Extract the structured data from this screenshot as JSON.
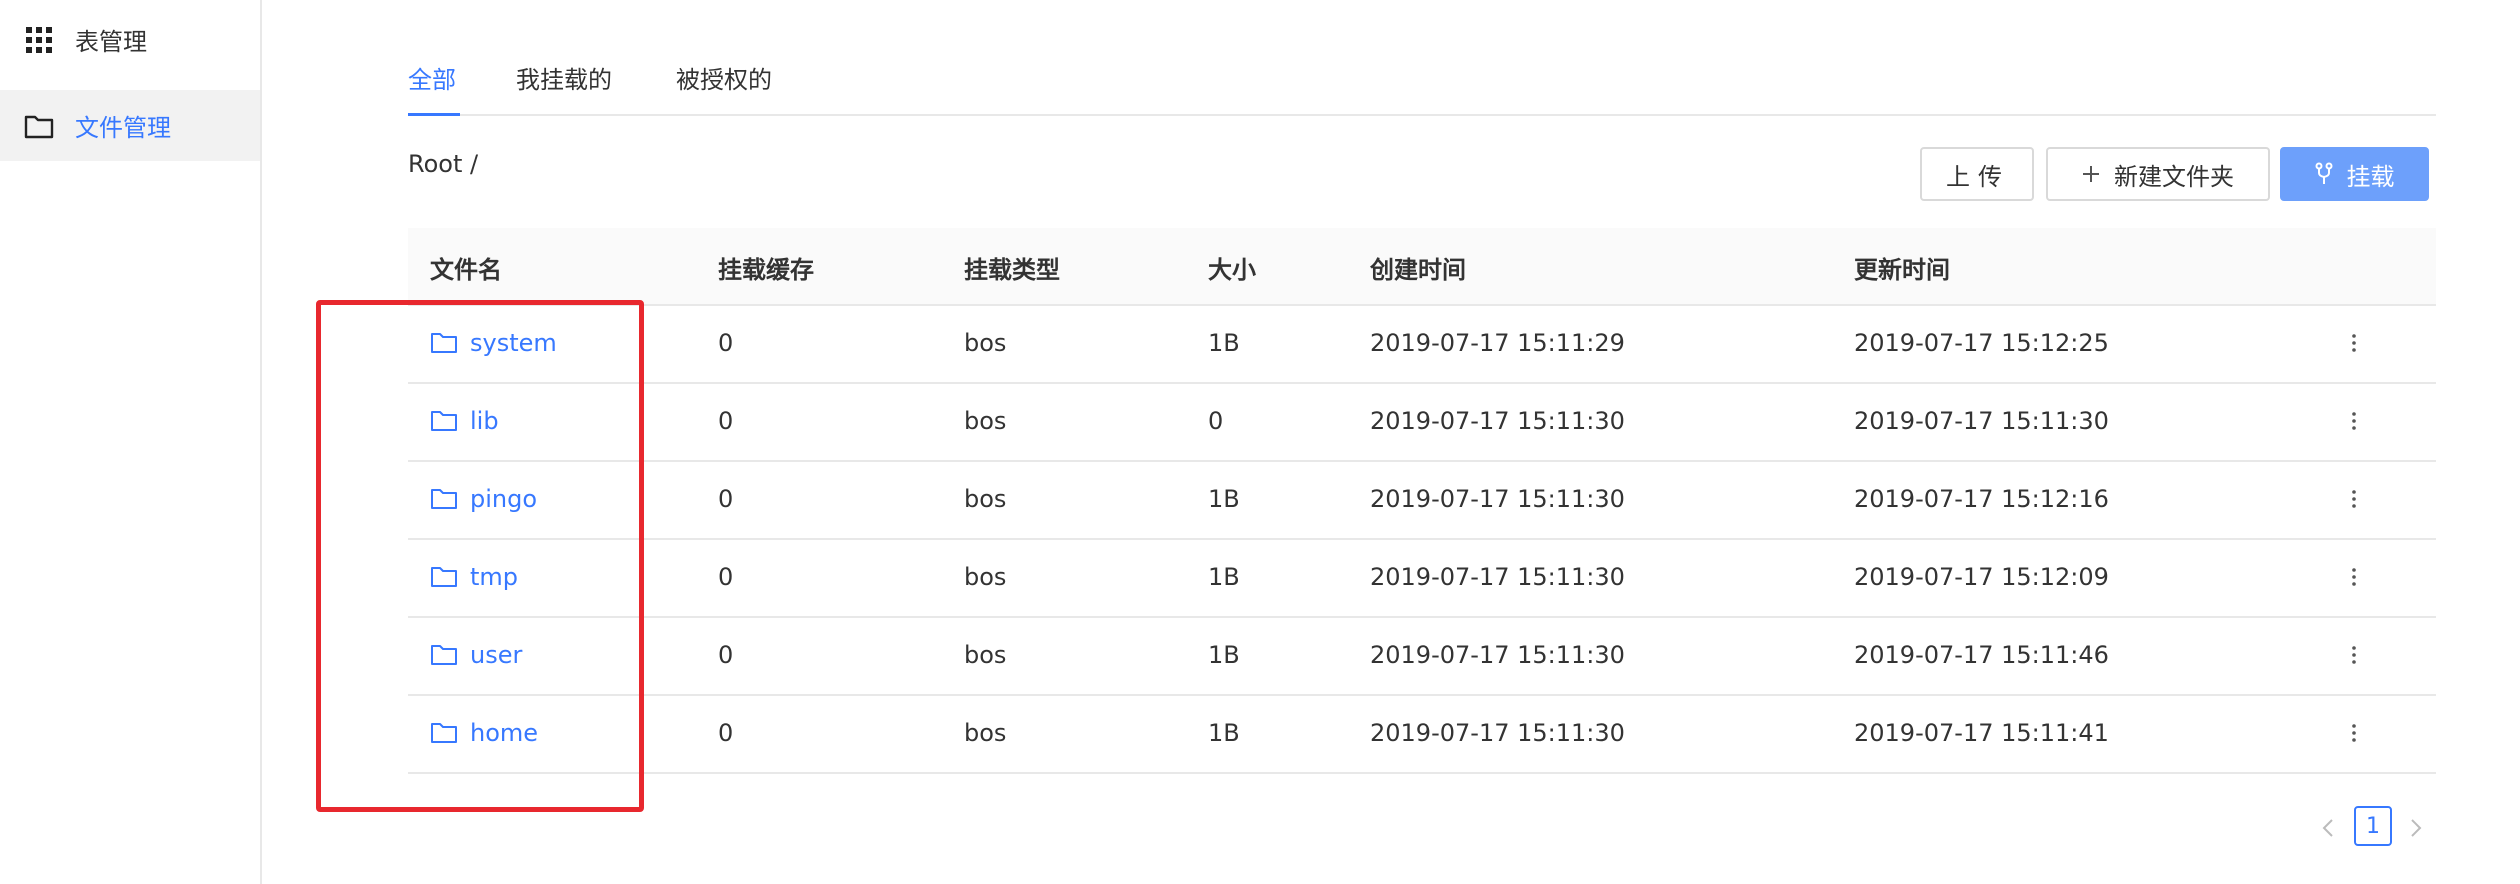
{
  "sidebar": {
    "items": [
      {
        "label": "表管理",
        "icon": "grid-icon"
      },
      {
        "label": "文件管理",
        "icon": "folder-icon",
        "active": true
      }
    ]
  },
  "tabs": [
    {
      "label": "全部",
      "active": true
    },
    {
      "label": "我挂载的"
    },
    {
      "label": "被授权的"
    }
  ],
  "breadcrumb": "Root /",
  "toolbar": {
    "upload_label": "上传",
    "new_folder_label": "新建文件夹",
    "mount_label": "挂载"
  },
  "table": {
    "headers": {
      "name": "文件名",
      "cache": "挂载缓存",
      "type": "挂载类型",
      "size": "大小",
      "created": "创建时间",
      "updated": "更新时间"
    },
    "rows": [
      {
        "name": "system",
        "cache": "0",
        "type": "bos",
        "size": "1B",
        "created": "2019-07-17 15:11:29",
        "updated": "2019-07-17 15:12:25"
      },
      {
        "name": "lib",
        "cache": "0",
        "type": "bos",
        "size": "0",
        "created": "2019-07-17 15:11:30",
        "updated": "2019-07-17 15:11:30"
      },
      {
        "name": "pingo",
        "cache": "0",
        "type": "bos",
        "size": "1B",
        "created": "2019-07-17 15:11:30",
        "updated": "2019-07-17 15:12:16"
      },
      {
        "name": "tmp",
        "cache": "0",
        "type": "bos",
        "size": "1B",
        "created": "2019-07-17 15:11:30",
        "updated": "2019-07-17 15:12:09"
      },
      {
        "name": "user",
        "cache": "0",
        "type": "bos",
        "size": "1B",
        "created": "2019-07-17 15:11:30",
        "updated": "2019-07-17 15:11:46"
      },
      {
        "name": "home",
        "cache": "0",
        "type": "bos",
        "size": "1B",
        "created": "2019-07-17 15:11:30",
        "updated": "2019-07-17 15:11:41"
      }
    ]
  },
  "pagination": {
    "current": "1"
  },
  "colors": {
    "accent": "#3778ff",
    "primary_button": "#6da0fb",
    "highlight": "#e8282e"
  }
}
